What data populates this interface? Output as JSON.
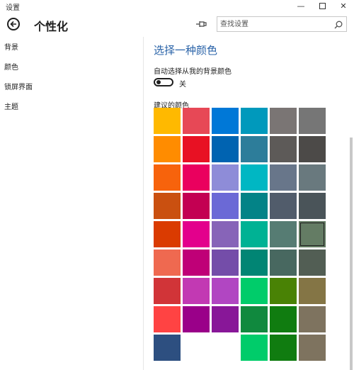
{
  "window": {
    "app_title": "设置",
    "minimize": "—",
    "close": "✕"
  },
  "header": {
    "title": "个性化",
    "search_placeholder": "查找设置"
  },
  "nav": {
    "items": [
      {
        "label": "背景"
      },
      {
        "label": "颜色"
      },
      {
        "label": "锁屏界面"
      },
      {
        "label": "主题"
      }
    ]
  },
  "content": {
    "section_title": "选择一种颜色",
    "auto_color_label": "自动选择从我的背景颜色",
    "toggle_state": "关",
    "suggested_label": "建议的颜色"
  },
  "colors": {
    "accent_text": "#2a63a8",
    "swatches": [
      [
        "#ffb900",
        "#e74856",
        "#0078d7",
        "#0099bc",
        "#7a7574",
        "#767676"
      ],
      [
        "#ff8c00",
        "#e81123",
        "#0063b1",
        "#2d7d9a",
        "#5d5a58",
        "#4c4a48"
      ],
      [
        "#f7630c",
        "#ea005e",
        "#8e8cd8",
        "#00b7c3",
        "#68768a",
        "#69797e"
      ],
      [
        "#ca5010",
        "#c30052",
        "#6b69d6",
        "#038387",
        "#515c6b",
        "#4a5459"
      ],
      [
        "#da3b01",
        "#e3008c",
        "#8764b8",
        "#00b294",
        "#567c73",
        "#647c64"
      ],
      [
        "#ef6950",
        "#bf0077",
        "#744da9",
        "#018574",
        "#486860",
        "#525e54"
      ],
      [
        "#d13438",
        "#c239b3",
        "#b146c2",
        "#00cc6a",
        "#498205",
        "#847545"
      ],
      [
        "#ff4343",
        "#9a0089",
        "#881798",
        "#10893e",
        "#107c10",
        "#7e735f"
      ],
      [
        "#2d4f80",
        "#ffffff",
        "#ffffff",
        "#00cc6a",
        "#107c10",
        "#7e735f"
      ]
    ],
    "selected": [
      4,
      5
    ]
  }
}
